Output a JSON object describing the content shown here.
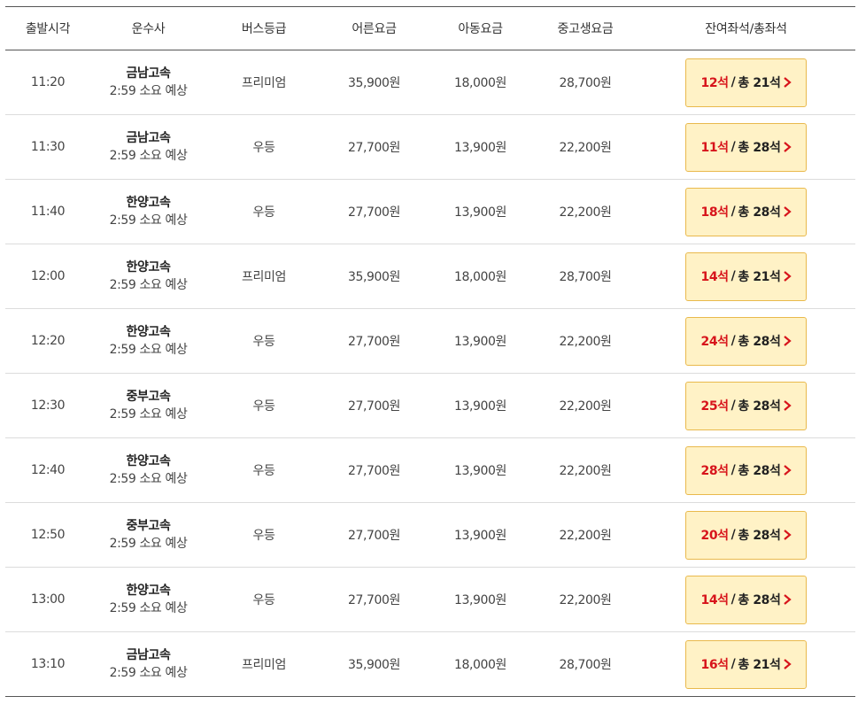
{
  "table": {
    "headers": [
      "출발시각",
      "운수사",
      "버스등급",
      "어른요금",
      "아동요금",
      "중고생요금",
      "잔여좌석/총좌석"
    ],
    "seat_separator": "/",
    "rows": [
      {
        "time": "11:20",
        "company": "금남고속",
        "duration": "2:59 소요 예상",
        "grade": "프리미엄",
        "adult": "35,900원",
        "child": "18,000원",
        "youth": "28,700원",
        "remaining": "12석",
        "total": "총 21석"
      },
      {
        "time": "11:30",
        "company": "금남고속",
        "duration": "2:59 소요 예상",
        "grade": "우등",
        "adult": "27,700원",
        "child": "13,900원",
        "youth": "22,200원",
        "remaining": "11석",
        "total": "총 28석"
      },
      {
        "time": "11:40",
        "company": "한양고속",
        "duration": "2:59 소요 예상",
        "grade": "우등",
        "adult": "27,700원",
        "child": "13,900원",
        "youth": "22,200원",
        "remaining": "18석",
        "total": "총 28석"
      },
      {
        "time": "12:00",
        "company": "한양고속",
        "duration": "2:59 소요 예상",
        "grade": "프리미엄",
        "adult": "35,900원",
        "child": "18,000원",
        "youth": "28,700원",
        "remaining": "14석",
        "total": "총 21석"
      },
      {
        "time": "12:20",
        "company": "한양고속",
        "duration": "2:59 소요 예상",
        "grade": "우등",
        "adult": "27,700원",
        "child": "13,900원",
        "youth": "22,200원",
        "remaining": "24석",
        "total": "총 28석"
      },
      {
        "time": "12:30",
        "company": "중부고속",
        "duration": "2:59 소요 예상",
        "grade": "우등",
        "adult": "27,700원",
        "child": "13,900원",
        "youth": "22,200원",
        "remaining": "25석",
        "total": "총 28석"
      },
      {
        "time": "12:40",
        "company": "한양고속",
        "duration": "2:59 소요 예상",
        "grade": "우등",
        "adult": "27,700원",
        "child": "13,900원",
        "youth": "22,200원",
        "remaining": "28석",
        "total": "총 28석"
      },
      {
        "time": "12:50",
        "company": "중부고속",
        "duration": "2:59 소요 예상",
        "grade": "우등",
        "adult": "27,700원",
        "child": "13,900원",
        "youth": "22,200원",
        "remaining": "20석",
        "total": "총 28석"
      },
      {
        "time": "13:00",
        "company": "한양고속",
        "duration": "2:59 소요 예상",
        "grade": "우등",
        "adult": "27,700원",
        "child": "13,900원",
        "youth": "22,200원",
        "remaining": "14석",
        "total": "총 28석"
      },
      {
        "time": "13:10",
        "company": "금남고속",
        "duration": "2:59 소요 예상",
        "grade": "프리미엄",
        "adult": "35,900원",
        "child": "18,000원",
        "youth": "28,700원",
        "remaining": "16석",
        "total": "총 21석"
      }
    ]
  },
  "colors": {
    "remaining_seats": "#d7141b",
    "seat_button_bg": "#fff2c6",
    "seat_button_border": "#e9b94c"
  },
  "icons": {
    "seat_button": "chevron-right-icon"
  }
}
